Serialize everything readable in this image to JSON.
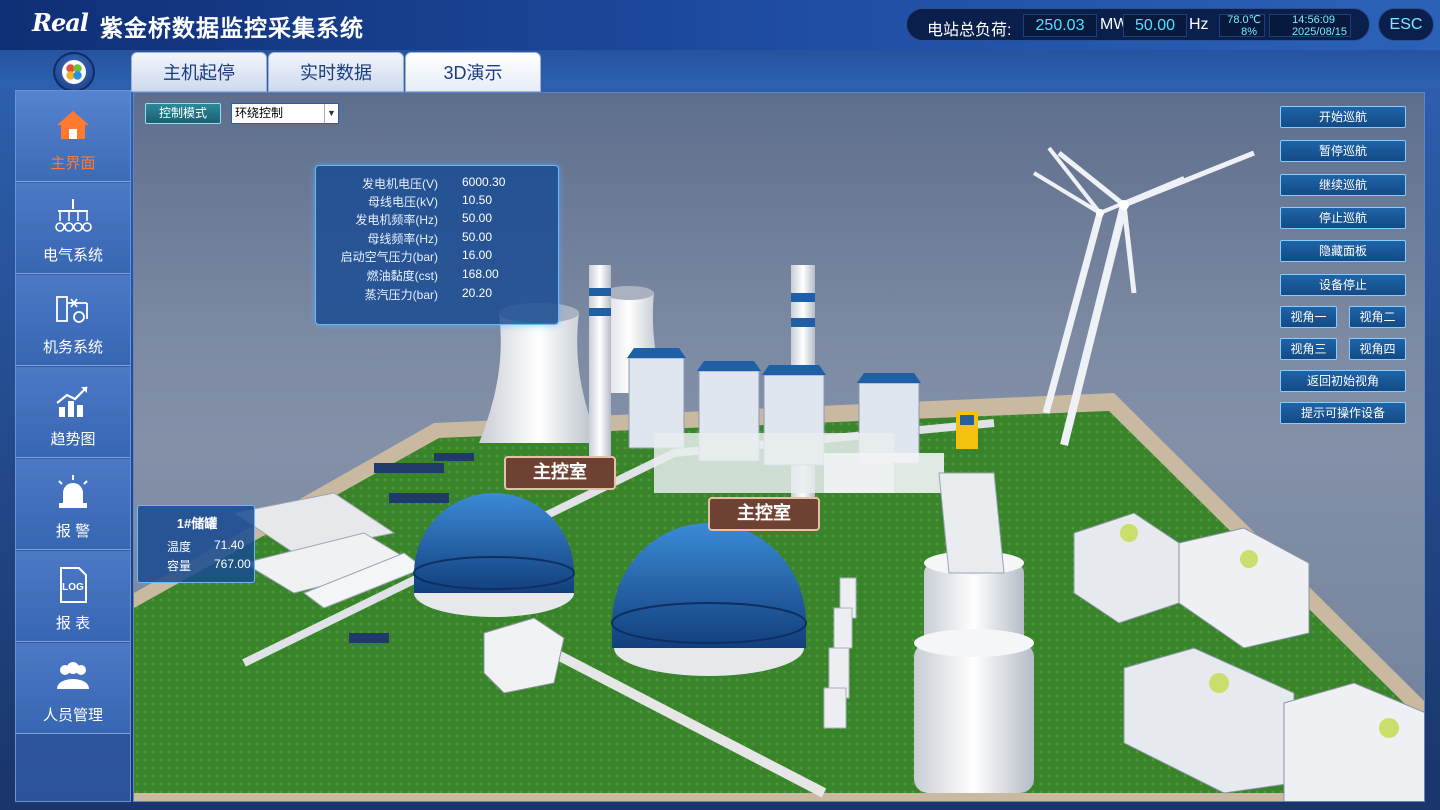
{
  "header": {
    "logo_text": "Real",
    "title": "紫金桥数据监控采集系统",
    "load_label": "电站总负荷:",
    "power_value": "250.03",
    "power_unit": "MW",
    "freq_value": "50.00",
    "freq_unit": "Hz",
    "temperature": "78.0℃",
    "humidity": "8%",
    "time": "14:56:09",
    "date": "2025/08/15",
    "esc_label": "ESC"
  },
  "sidebar": {
    "items": [
      {
        "label": "主界面",
        "icon": "home-icon",
        "active": true
      },
      {
        "label": "电气系统",
        "icon": "electrical-icon"
      },
      {
        "label": "机务系统",
        "icon": "mechanical-icon"
      },
      {
        "label": "趋势图",
        "icon": "trend-chart-icon"
      },
      {
        "label": "报  警",
        "icon": "alarm-light-icon"
      },
      {
        "label": "报  表",
        "icon": "log-report-icon"
      },
      {
        "label": "人员管理",
        "icon": "people-icon"
      }
    ]
  },
  "tabs": [
    {
      "label": "主机起停"
    },
    {
      "label": "实时数据"
    },
    {
      "label": "3D演示",
      "active": true
    }
  ],
  "control": {
    "mode_label": "控制模式",
    "mode_value": "环绕控制"
  },
  "right_buttons": {
    "start_tour": "开始巡航",
    "pause_tour": "暂停巡航",
    "resume_tour": "继续巡航",
    "stop_tour": "停止巡航",
    "hide_panel": "隐藏面板",
    "device_stop": "设备停止",
    "view1": "视角一",
    "view2": "视角二",
    "view3": "视角三",
    "view4": "视角四",
    "reset_view": "返回初始视角",
    "show_devices": "提示可操作设备"
  },
  "info_panel": {
    "rows": [
      {
        "k": "发电机电压(V)",
        "v": "6000.30"
      },
      {
        "k": "母线电压(kV)",
        "v": "10.50"
      },
      {
        "k": "发电机频率(Hz)",
        "v": "50.00"
      },
      {
        "k": "母线频率(Hz)",
        "v": "50.00"
      },
      {
        "k": "启动空气压力(bar)",
        "v": "16.00"
      },
      {
        "k": "燃油黏度(cst)",
        "v": "168.00"
      },
      {
        "k": "蒸汽压力(bar)",
        "v": "20.20"
      }
    ]
  },
  "tank_panel": {
    "title": "1#储罐",
    "temp_label": "温度",
    "temp_value": "71.40",
    "capacity_label": "容量",
    "capacity_value": "767.00"
  },
  "labels": {
    "control_room_1": "主控室",
    "control_room_2": "主控室"
  },
  "colors": {
    "accent_cyan": "#4ee3ff",
    "active_orange": "#ff7a2f",
    "dome_blue": "#1e5fa6",
    "grass": "#3f8c2e"
  }
}
